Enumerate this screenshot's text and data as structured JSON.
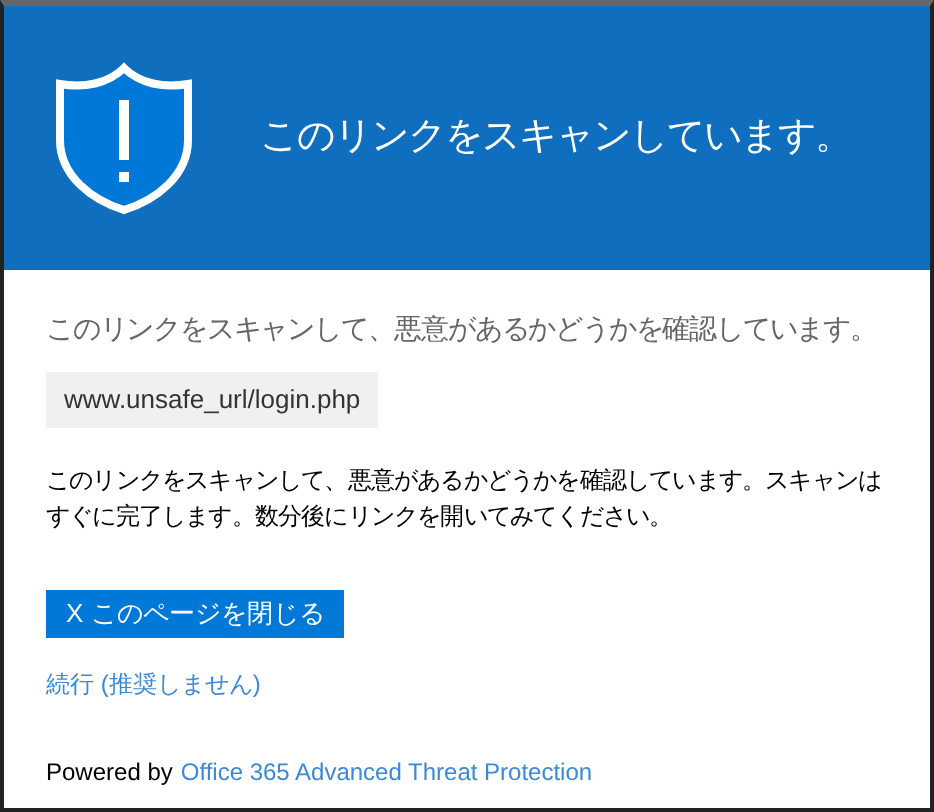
{
  "header": {
    "title": "このリンクをスキャンしています。"
  },
  "heading": "このリンクをスキャンして、悪意があるかどうかを確認しています。",
  "url": "www.unsafe_url/login.php",
  "message": "このリンクをスキャンして、悪意があるかどうかを確認しています。スキャンはすぐに完了します。数分後にリンクを開いてみてください。",
  "close_button": "X このページを閉じる",
  "continue_link": "続行 (推奨しません)",
  "footer": {
    "prefix": "Powered by",
    "link": "Office 365 Advanced Threat Protection"
  }
}
